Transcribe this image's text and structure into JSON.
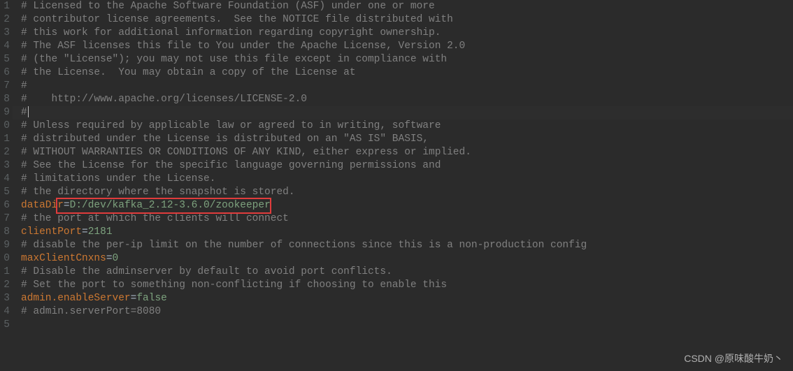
{
  "gutter": [
    "1",
    "2",
    "3",
    "4",
    "5",
    "6",
    "7",
    "8",
    "9",
    "0",
    "1",
    "2",
    "3",
    "4",
    "5",
    "6",
    "7",
    "8",
    "9",
    "0",
    "1",
    "2",
    "3",
    "4",
    "5"
  ],
  "lines": {
    "l1": "# Licensed to the Apache Software Foundation (ASF) under one or more",
    "l2": "# contributor license agreements.  See the NOTICE file distributed with",
    "l3": "# this work for additional information regarding copyright ownership.",
    "l4": "# The ASF licenses this file to You under the Apache License, Version 2.0",
    "l5": "# (the \"License\"); you may not use this file except in compliance with",
    "l6": "# the License.  You may obtain a copy of the License at",
    "l7": "#",
    "l8": "#    http://www.apache.org/licenses/LICENSE-2.0",
    "l9": "#",
    "l10": "# Unless required by applicable law or agreed to in writing, software",
    "l11": "# distributed under the License is distributed on an \"AS IS\" BASIS,",
    "l12": "# WITHOUT WARRANTIES OR CONDITIONS OF ANY KIND, either express or implied.",
    "l13": "# See the License for the specific language governing permissions and",
    "l14": "# limitations under the License.",
    "l15": "# the directory where the snapshot is stored.",
    "kv16": {
      "key": "dataDir",
      "value": "D:/dev/kafka_2.12-3.6.0/zookeeper"
    },
    "l17": "# the port at which the clients will connect",
    "kv18": {
      "key": "clientPort",
      "value": "2181"
    },
    "l19": "# disable the per-ip limit on the number of connections since this is a non-production config",
    "kv20": {
      "key": "maxClientCnxns",
      "value": "0"
    },
    "l21": "# Disable the adminserver by default to avoid port conflicts.",
    "l22": "# Set the port to something non-conflicting if choosing to enable this",
    "kv23": {
      "key": "admin.enableServer",
      "value": "false"
    },
    "l24": "# admin.serverPort=8080"
  },
  "watermark": "CSDN @原味酸牛奶丶",
  "equals": "="
}
